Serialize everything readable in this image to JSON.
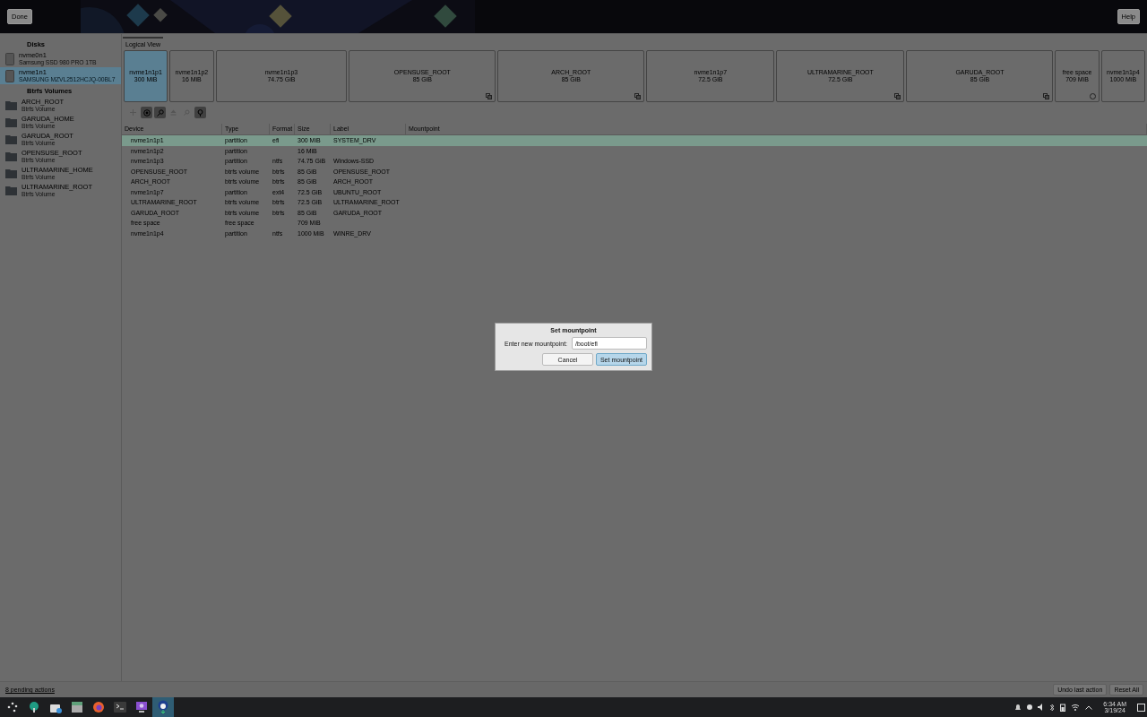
{
  "top_bar": {
    "done": "Done",
    "help": "Help"
  },
  "sidebar": {
    "sections": [
      {
        "title": "Disks",
        "items": [
          {
            "name": "nvme0n1",
            "subtitle": "Samsung SSD 980 PRO 1TB",
            "kind": "disk",
            "selected": false
          },
          {
            "name": "nvme1n1",
            "subtitle": "SAMSUNG MZVL2512HCJQ-00BL7",
            "kind": "disk",
            "selected": true
          }
        ]
      },
      {
        "title": "Btrfs Volumes",
        "items": [
          {
            "name": "ARCH_ROOT",
            "subtitle": "Btrfs Volume",
            "kind": "volume",
            "selected": false
          },
          {
            "name": "GARUDA_HOME",
            "subtitle": "Btrfs Volume",
            "kind": "volume",
            "selected": false
          },
          {
            "name": "GARUDA_ROOT",
            "subtitle": "Btrfs Volume",
            "kind": "volume",
            "selected": false
          },
          {
            "name": "OPENSUSE_ROOT",
            "subtitle": "Btrfs Volume",
            "kind": "volume",
            "selected": false
          },
          {
            "name": "ULTRAMARINE_HOME",
            "subtitle": "Btrfs Volume",
            "kind": "volume",
            "selected": false
          },
          {
            "name": "ULTRAMARINE_ROOT",
            "subtitle": "Btrfs Volume",
            "kind": "volume",
            "selected": false
          }
        ]
      }
    ]
  },
  "view_tab": {
    "label": "Logical View",
    "selected": true
  },
  "partitions": [
    {
      "name": "nvme1n1p1",
      "size": "300 MiB",
      "kind": "plain",
      "selected": true
    },
    {
      "name": "nvme1n1p2",
      "size": "16 MiB",
      "kind": "plain",
      "selected": false
    },
    {
      "name": "nvme1n1p3",
      "size": "74.75 GiB",
      "kind": "plain",
      "selected": false
    },
    {
      "name": "OPENSUSE_ROOT",
      "size": "85 GiB",
      "kind": "btrfs",
      "selected": false
    },
    {
      "name": "ARCH_ROOT",
      "size": "85 GiB",
      "kind": "btrfs",
      "selected": false
    },
    {
      "name": "nvme1n1p7",
      "size": "72.5 GiB",
      "kind": "plain",
      "selected": false
    },
    {
      "name": "ULTRAMARINE_ROOT",
      "size": "72.5 GiB",
      "kind": "btrfs",
      "selected": false
    },
    {
      "name": "GARUDA_ROOT",
      "size": "85 GiB",
      "kind": "btrfs",
      "selected": false
    },
    {
      "name": "free space",
      "size": "709 MiB",
      "kind": "free",
      "selected": false
    },
    {
      "name": "nvme1n1p4",
      "size": "1000 MiB",
      "kind": "plain",
      "selected": false
    }
  ],
  "tools": [
    {
      "kind": "add",
      "disabled": true
    },
    {
      "kind": "target",
      "disabled": false
    },
    {
      "kind": "key",
      "disabled": false
    },
    {
      "kind": "eject",
      "disabled": true
    },
    {
      "kind": "search",
      "disabled": true
    },
    {
      "kind": "pin",
      "disabled": false
    }
  ],
  "table": {
    "columns": [
      "Device",
      "Type",
      "Format",
      "Size",
      "Label",
      "Mountpoint"
    ],
    "rows": [
      {
        "cells": [
          "nvme1n1p1",
          "partition",
          "efi",
          "300 MiB",
          "SYSTEM_DRV",
          ""
        ],
        "selected": true
      },
      {
        "cells": [
          "nvme1n1p2",
          "partition",
          "",
          "16 MiB",
          "",
          ""
        ],
        "selected": false
      },
      {
        "cells": [
          "nvme1n1p3",
          "partition",
          "ntfs",
          "74.75 GiB",
          "Windows-SSD",
          ""
        ],
        "selected": false
      },
      {
        "cells": [
          "OPENSUSE_ROOT",
          "btrfs volume",
          "btrfs",
          "85 GiB",
          "OPENSUSE_ROOT",
          ""
        ],
        "selected": false
      },
      {
        "cells": [
          "ARCH_ROOT",
          "btrfs volume",
          "btrfs",
          "85 GiB",
          "ARCH_ROOT",
          ""
        ],
        "selected": false
      },
      {
        "cells": [
          "nvme1n1p7",
          "partition",
          "ext4",
          "72.5 GiB",
          "UBUNTU_ROOT",
          ""
        ],
        "selected": false
      },
      {
        "cells": [
          "ULTRAMARINE_ROOT",
          "btrfs volume",
          "btrfs",
          "72.5 GiB",
          "ULTRAMARINE_ROOT",
          ""
        ],
        "selected": false
      },
      {
        "cells": [
          "GARUDA_ROOT",
          "btrfs volume",
          "btrfs",
          "85 GiB",
          "GARUDA_ROOT",
          ""
        ],
        "selected": false
      },
      {
        "cells": [
          "free space",
          "free space",
          "",
          "709 MiB",
          "",
          ""
        ],
        "selected": false
      },
      {
        "cells": [
          "nvme1n1p4",
          "partition",
          "ntfs",
          "1000 MiB",
          "WINRE_DRV",
          ""
        ],
        "selected": false
      }
    ]
  },
  "dialog": {
    "title": "Set mountpoint",
    "label": "Enter new mountpoint:",
    "value": "/boot/efi",
    "buttons": [
      {
        "label": "Cancel",
        "primary": false
      },
      {
        "label": "Set mountpoint",
        "primary": true
      }
    ]
  },
  "footer": {
    "pending": "8 pending actions",
    "buttons": [
      "Undo last action",
      "Reset All"
    ]
  },
  "taskbar": {
    "apps": [
      {
        "kind": "launcher",
        "active": false
      },
      {
        "kind": "settings",
        "active": false
      },
      {
        "kind": "store",
        "active": false
      },
      {
        "kind": "files",
        "active": false
      },
      {
        "kind": "browser",
        "active": false
      },
      {
        "kind": "terminal",
        "active": false
      },
      {
        "kind": "monitor",
        "active": false
      },
      {
        "kind": "installer",
        "active": true
      }
    ],
    "time": "6:34 AM",
    "date": "3/19/24"
  }
}
